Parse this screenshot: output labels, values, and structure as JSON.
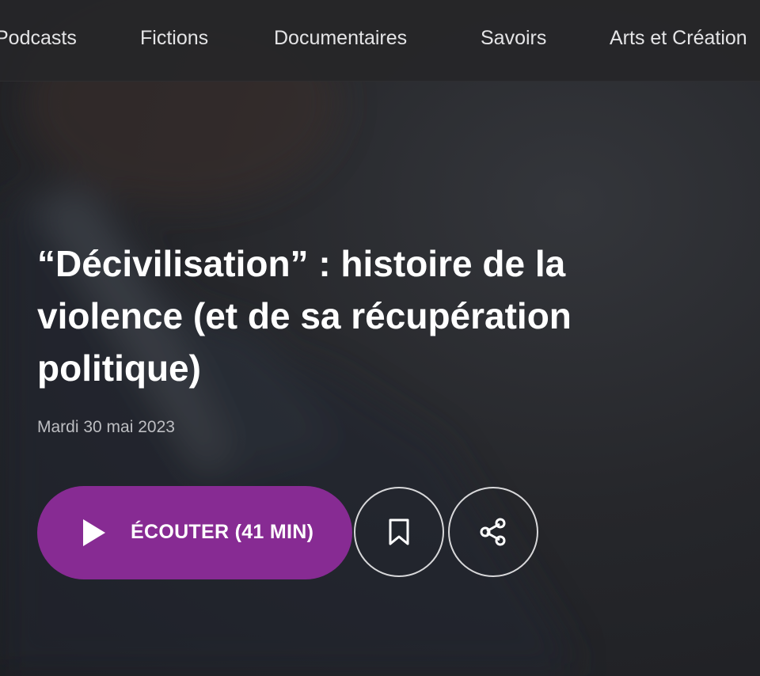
{
  "nav": {
    "items": [
      {
        "label": "Podcasts"
      },
      {
        "label": "Fictions"
      },
      {
        "label": "Documentaires"
      },
      {
        "label": "Savoirs"
      },
      {
        "label": "Arts et Création"
      }
    ]
  },
  "episode": {
    "title": "“Décivilisation” : histoire de la violence (et de sa récupération politique)",
    "date": "Mardi 30 mai 2023"
  },
  "actions": {
    "listen_label": "ÉCOUTER (41 MIN)",
    "play_icon": "play-icon",
    "bookmark_icon": "bookmark-icon",
    "share_icon": "share-icon"
  },
  "colors": {
    "accent": "#872b93",
    "background": "#1d1e22",
    "nav_background": "#262628"
  }
}
